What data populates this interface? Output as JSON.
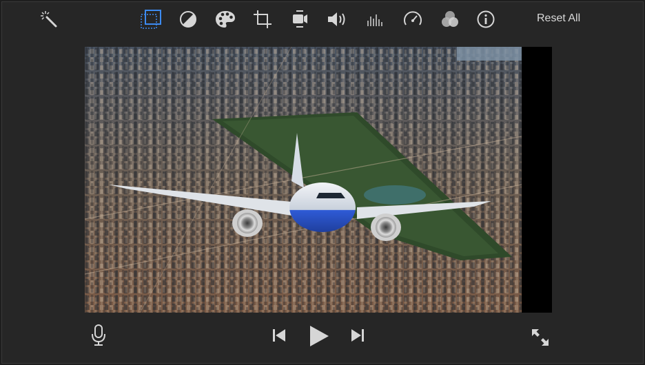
{
  "toolbar": {
    "tools": [
      {
        "icon": "magic-wand-icon",
        "selected": false
      },
      {
        "icon": "crop-to-fill-icon",
        "selected": true
      },
      {
        "icon": "color-balance-icon",
        "selected": false
      },
      {
        "icon": "color-palette-icon",
        "selected": false
      },
      {
        "icon": "crop-icon",
        "selected": false
      },
      {
        "icon": "stabilization-camera-icon",
        "selected": false
      },
      {
        "icon": "volume-icon",
        "selected": false
      },
      {
        "icon": "equalizer-icon",
        "selected": false
      },
      {
        "icon": "speedometer-icon",
        "selected": false
      },
      {
        "icon": "clip-filter-icon",
        "selected": false
      },
      {
        "icon": "info-icon",
        "selected": false
      }
    ],
    "reset_all_label": "Reset All"
  },
  "controls": {
    "icons": [
      "microphone-icon",
      "skip-back-icon",
      "play-icon",
      "skip-forward-icon",
      "fullscreen-icon"
    ]
  },
  "colors": {
    "accent": "#3d8bf2",
    "icon": "#d6d6d6",
    "background": "#262626"
  }
}
